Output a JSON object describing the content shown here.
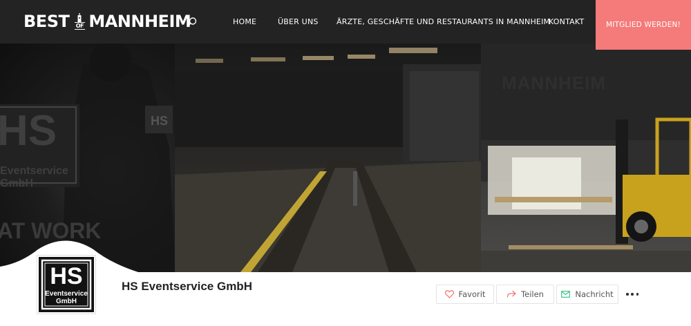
{
  "brand": {
    "logo_word_1": "BEST",
    "logo_of": "OF",
    "logo_word_2": "MANNHEIM",
    "logo_text": "BEST OF MANNHEIM"
  },
  "nav": {
    "search_icon": "search-icon",
    "items": [
      {
        "label": "HOME"
      },
      {
        "label": "ÜBER UNS"
      },
      {
        "label": "ÄRZTE, GESCHÄFTE UND RESTAURANTS IN MANNHEIM"
      },
      {
        "label": "KONTAKT"
      }
    ],
    "cta_label": "MITGLIED WERDEN!"
  },
  "cover": {
    "panel1_logo_top": "HS",
    "panel1_logo_bottom": "Eventservice GmbH",
    "panel1_caption": "AT WORK",
    "panel3_banner": "MANNHEIM"
  },
  "profile": {
    "company_name": "HS Eventservice GmbH",
    "avatar_logo_top": "HS",
    "avatar_logo_line1": "Eventservice",
    "avatar_logo_line2": "GmbH",
    "actions": {
      "favorite_label": "Favorit",
      "share_label": "Teilen",
      "message_label": "Nachricht"
    }
  },
  "colors": {
    "header_bg": "#232323",
    "cta_bg": "#f47b79",
    "heart_icon": "#f2787a",
    "share_icon": "#f2787a",
    "mail_icon": "#3cc58a"
  }
}
